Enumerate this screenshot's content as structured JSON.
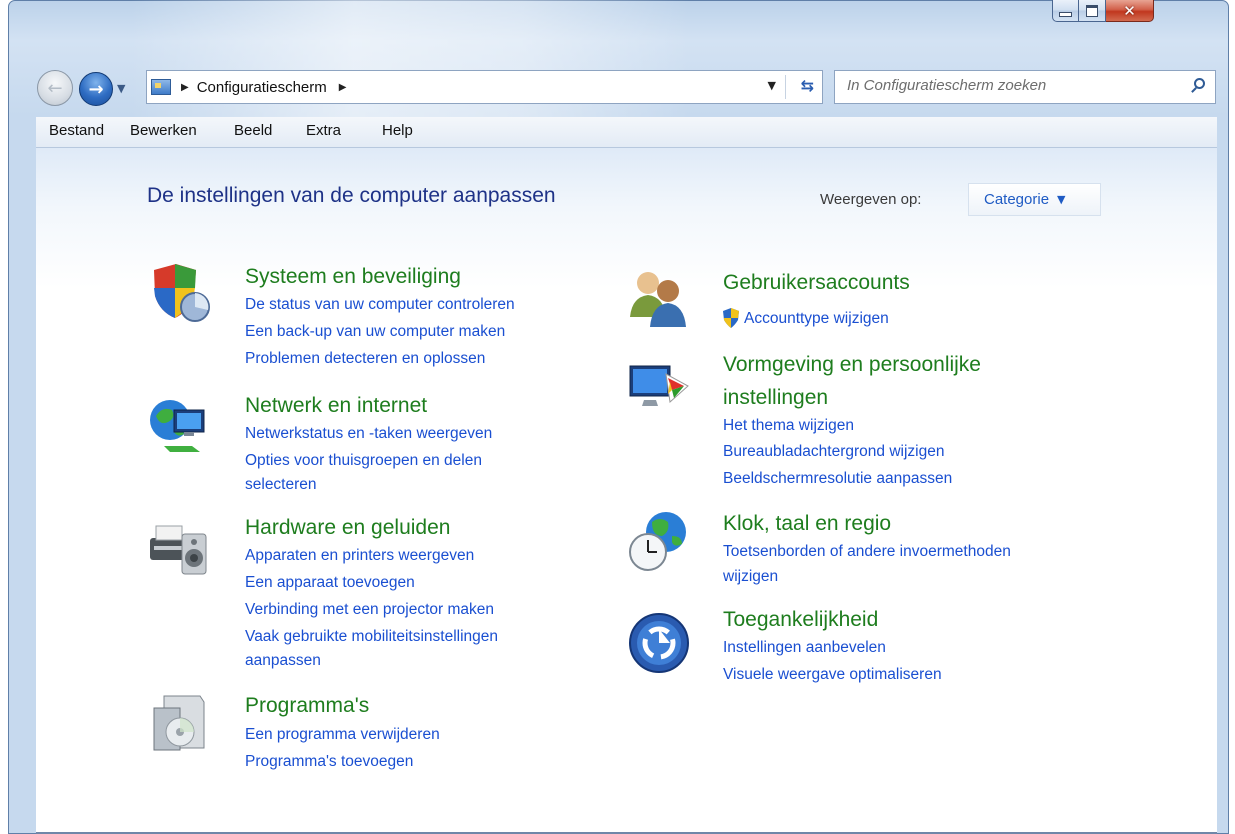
{
  "window": {
    "address_text": "Configuratiescherm",
    "search_placeholder": "In Configuratiescherm zoeken"
  },
  "menu": [
    "Bestand",
    "Bewerken",
    "Beeld",
    "Extra",
    "Help"
  ],
  "header": {
    "title": "De instellingen van de computer aanpassen",
    "view_label": "Weergeven op:",
    "view_value": "Categorie"
  },
  "categories": [
    {
      "title": "Systeem en beveiliging",
      "icon": "shield-chart-icon",
      "links": [
        "De status van uw computer controleren",
        "Een back-up van uw computer maken",
        "Problemen detecteren en oplossen"
      ]
    },
    {
      "title": "Netwerk en internet",
      "icon": "network-globe-icon",
      "links": [
        "Netwerkstatus en -taken weergeven",
        "Opties voor thuisgroepen en delen",
        "selecteren"
      ]
    },
    {
      "title": "Hardware en geluiden",
      "icon": "printer-speaker-icon",
      "links": [
        "Apparaten en printers weergeven",
        "Een apparaat toevoegen",
        "Verbinding met een projector maken",
        "Vaak gebruikte mobiliteitsinstellingen",
        "aanpassen"
      ]
    },
    {
      "title": "Programma's",
      "icon": "program-box-icon",
      "links": [
        "Een programma verwijderen",
        "Programma's toevoegen"
      ]
    },
    {
      "title": "Gebruikersaccounts",
      "icon": "users-icon",
      "links": [
        "Accounttype wijzigen"
      ]
    },
    {
      "title_line1": "Vormgeving en persoonlijke",
      "title_line2": "instellingen",
      "icon": "monitor-palette-icon",
      "links": [
        "Het thema wijzigen",
        "Bureaubladachtergrond wijzigen",
        "Beeldschermresolutie aanpassen"
      ]
    },
    {
      "title": "Klok, taal en regio",
      "icon": "globe-clock-icon",
      "links": [
        "Toetsenborden of andere invoermethoden",
        "wijzigen"
      ]
    },
    {
      "title": "Toegankelijkheid",
      "icon": "accessibility-icon",
      "links": [
        "Instellingen aanbevelen",
        "Visuele weergave optimaliseren"
      ]
    }
  ]
}
